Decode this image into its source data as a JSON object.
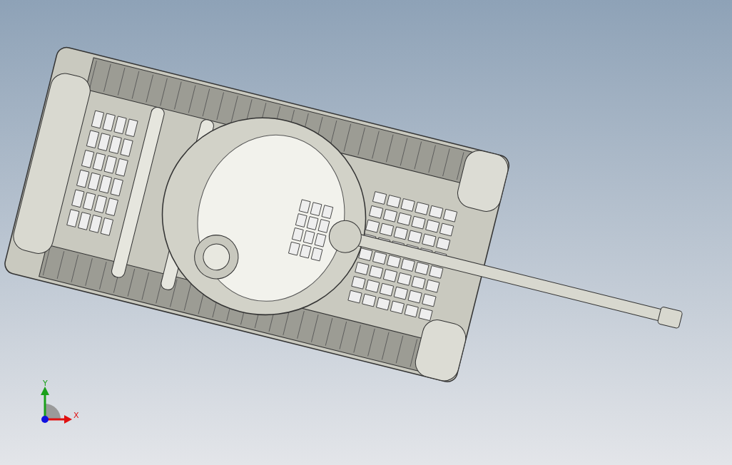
{
  "viewport": {
    "model": {
      "kind": "tank"
    },
    "triad": {
      "axes": [
        {
          "kind": "y",
          "label": "Y"
        },
        {
          "kind": "x",
          "label": "X"
        }
      ]
    }
  }
}
